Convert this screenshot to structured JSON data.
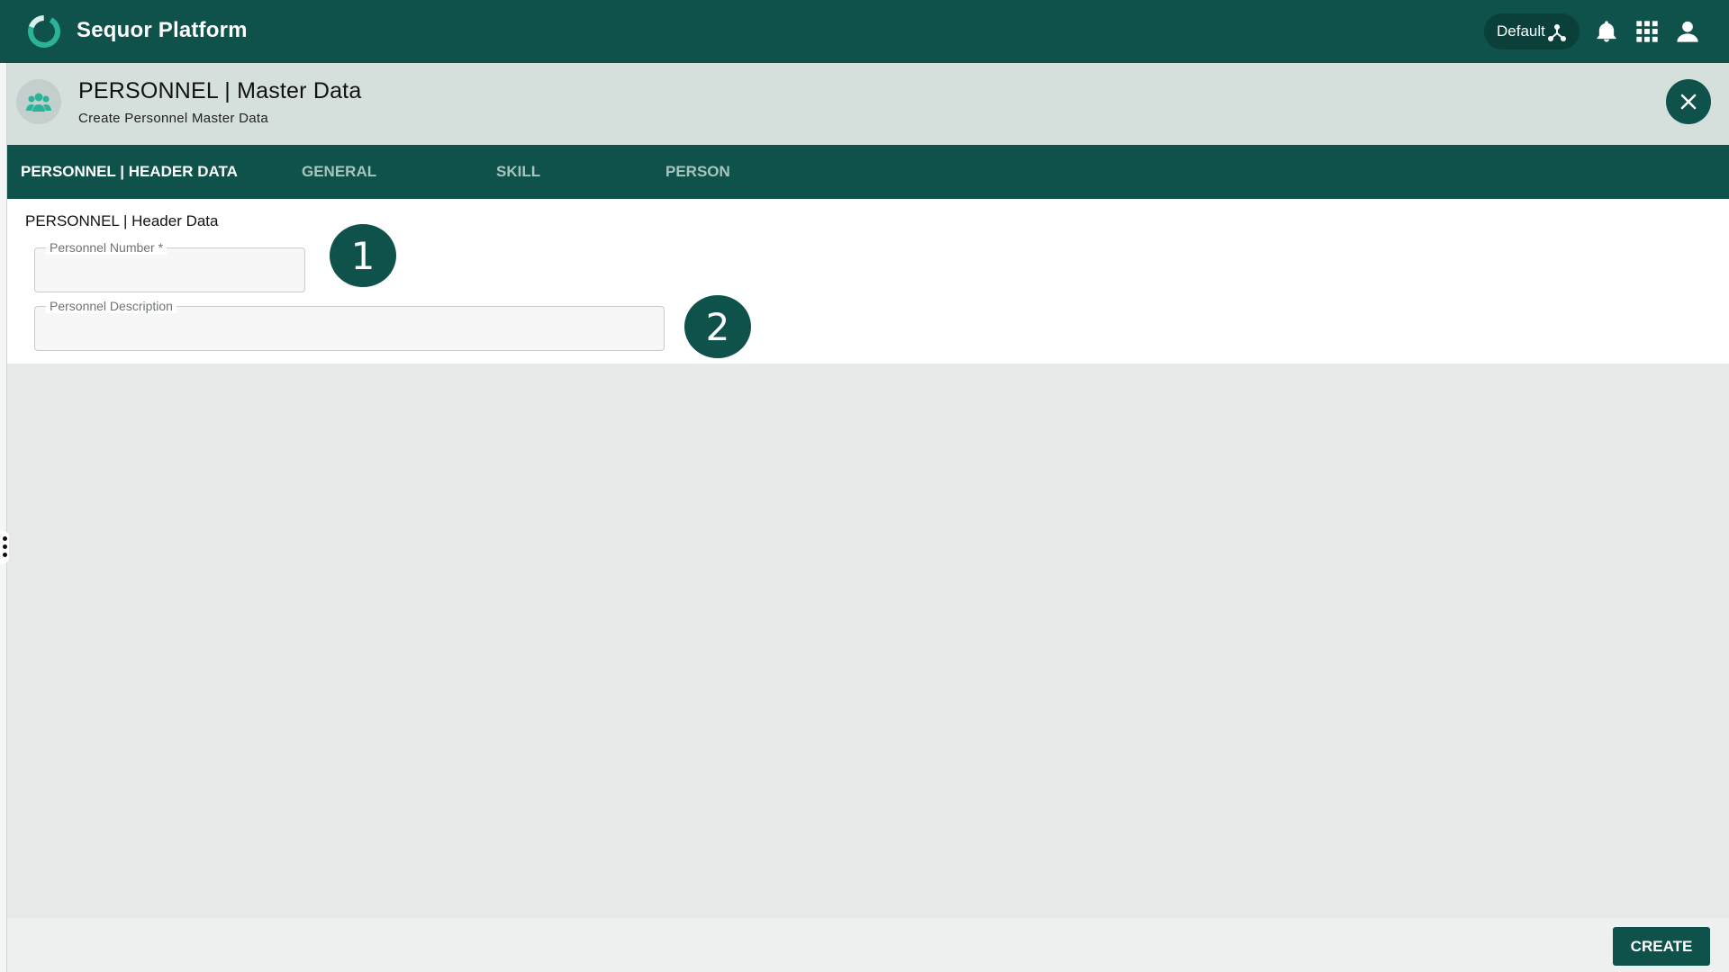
{
  "app": {
    "title": "Sequor Platform",
    "tenant_label": "Default",
    "icons": [
      "sequor-logo",
      "hierarchy-icon",
      "bell-icon",
      "apps-grid-icon",
      "user-icon"
    ]
  },
  "page": {
    "title": "PERSONNEL | Master Data",
    "subtitle": "Create Personnel Master Data",
    "avatar_icon": "people-group-icon",
    "close_icon": "close-icon"
  },
  "tabs": [
    {
      "label": "PERSONNEL | HEADER DATA",
      "active": true
    },
    {
      "label": "GENERAL",
      "active": false
    },
    {
      "label": "SKILL",
      "active": false
    },
    {
      "label": "PERSON",
      "active": false
    }
  ],
  "form": {
    "section_title": "PERSONNEL | Header Data",
    "fields": [
      {
        "label": "Personnel Number *",
        "value": ""
      },
      {
        "label": "Personnel Description",
        "value": ""
      }
    ],
    "badges": [
      "1",
      "2"
    ]
  },
  "footer": {
    "create_label": "CREATE"
  },
  "colors": {
    "primary": "#0f524b",
    "header_bg": "#d5e0dd",
    "accent": "#2bb39a",
    "content_bg": "#e7e9e8"
  }
}
